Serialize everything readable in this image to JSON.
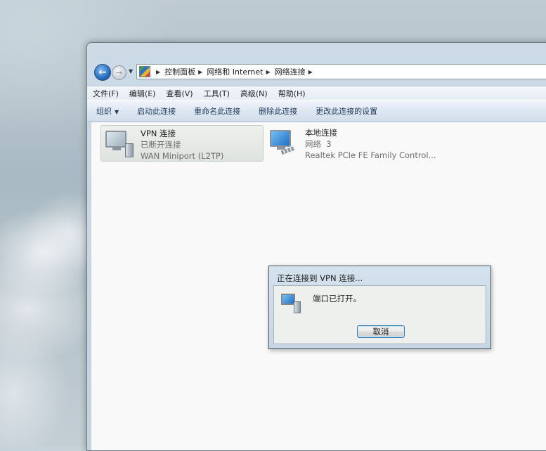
{
  "breadcrumb": [
    "控制面板",
    "网络和 Internet",
    "网络连接"
  ],
  "menu": [
    "文件(F)",
    "编辑(E)",
    "查看(V)",
    "工具(T)",
    "高级(N)",
    "帮助(H)"
  ],
  "commands": {
    "organize": "组织",
    "start": "启动此连接",
    "rename": "重命名此连接",
    "delete": "删除此连接",
    "settings": "更改此连接的设置"
  },
  "connections": [
    {
      "name": "VPN 连接",
      "status": "已断开连接",
      "device": "WAN Miniport (L2TP)",
      "icon": "vpn-connection-icon"
    },
    {
      "name": "本地连接",
      "status": "网络  3",
      "device": "Realtek PCIe FE Family Control...",
      "icon": "local-connection-icon"
    }
  ],
  "dialog": {
    "title": "正在连接到 VPN 连接...",
    "status": "端口已打开。",
    "cancel_label": "取消",
    "icon": "vpn-connection-icon"
  },
  "colors": {
    "accent": "#1e395b",
    "back_button": "#1d62b8"
  }
}
